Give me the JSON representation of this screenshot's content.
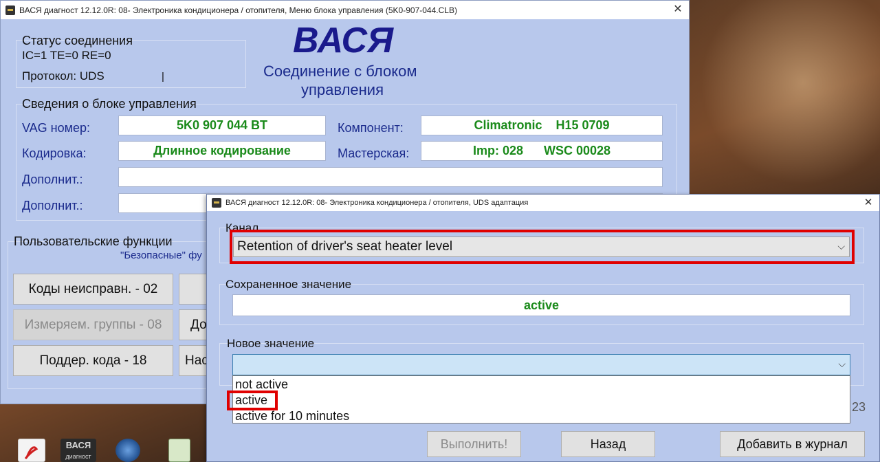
{
  "main_window": {
    "title": "ВАСЯ диагност 12.12.0R: 08- Электроника кондиционера / отопителя,  Меню блока управления (5K0-907-044.CLB)",
    "close_glyph": "✕",
    "logo": "ВАСЯ",
    "connection_heading_1": "Соединение с блоком",
    "connection_heading_2": "управления",
    "status": {
      "title": "Статус соединения",
      "ic_te_re": "IC=1  TE=0   RE=0",
      "protocol": "Протокол: UDS",
      "cursor": "|"
    },
    "module_info": {
      "title": "Сведения о блоке управления",
      "vag_label": "VAG номер:",
      "vag_value": "5K0 907 044 BT",
      "component_label": "Компонент:",
      "component_value": "Climatronic    H15 0709",
      "coding_label": "Кодировка:",
      "coding_value": "Длинное кодирование",
      "workshop_label": "Мастерская:",
      "workshop_value": "Imp: 028      WSC 00028",
      "extra1_label": "Дополнит.:",
      "extra1_value": "",
      "extra2_label": "Дополнит.:",
      "extra2_value": ""
    },
    "functions": {
      "title": "Пользовательские функции",
      "safe_label": "\"Безопасные\" фу",
      "btn_fault_codes": "Коды неисправн. - 02",
      "btn_measure_groups": "Измеряем. группы - 08",
      "btn_support_codes": "Поддер. кода - 18",
      "btn_partial_1": "До",
      "btn_partial_2": "Нас"
    },
    "behind_partial_left": "Ко",
    "behind_partial_right": "23"
  },
  "dialog": {
    "title": "ВАСЯ диагност 12.12.0R: 08- Электроника кондиционера / отопителя,  UDS адаптация",
    "close_glyph": "✕",
    "channel_label": "Канал",
    "channel_value": "Retention of driver's seat heater level",
    "saved_label": "Сохраненное значение",
    "saved_value": "active",
    "new_label": "Новое значение",
    "new_value": "",
    "chevron_glyph": "⌵",
    "options": [
      "not active",
      "active",
      "active for 10 minutes"
    ],
    "btn_execute": "Выполнить!",
    "btn_back": "Назад",
    "btn_add_log": "Добавить в журнал"
  },
  "taskbar": {
    "vasya_icon_text": "ВАСЯ",
    "vasya_icon_sub": "диагност"
  },
  "colors": {
    "window_bg": "#b8c8ec",
    "navy_text": "#1a2a8c",
    "value_green": "#1a8a1a",
    "highlight_red": "#e00000"
  }
}
